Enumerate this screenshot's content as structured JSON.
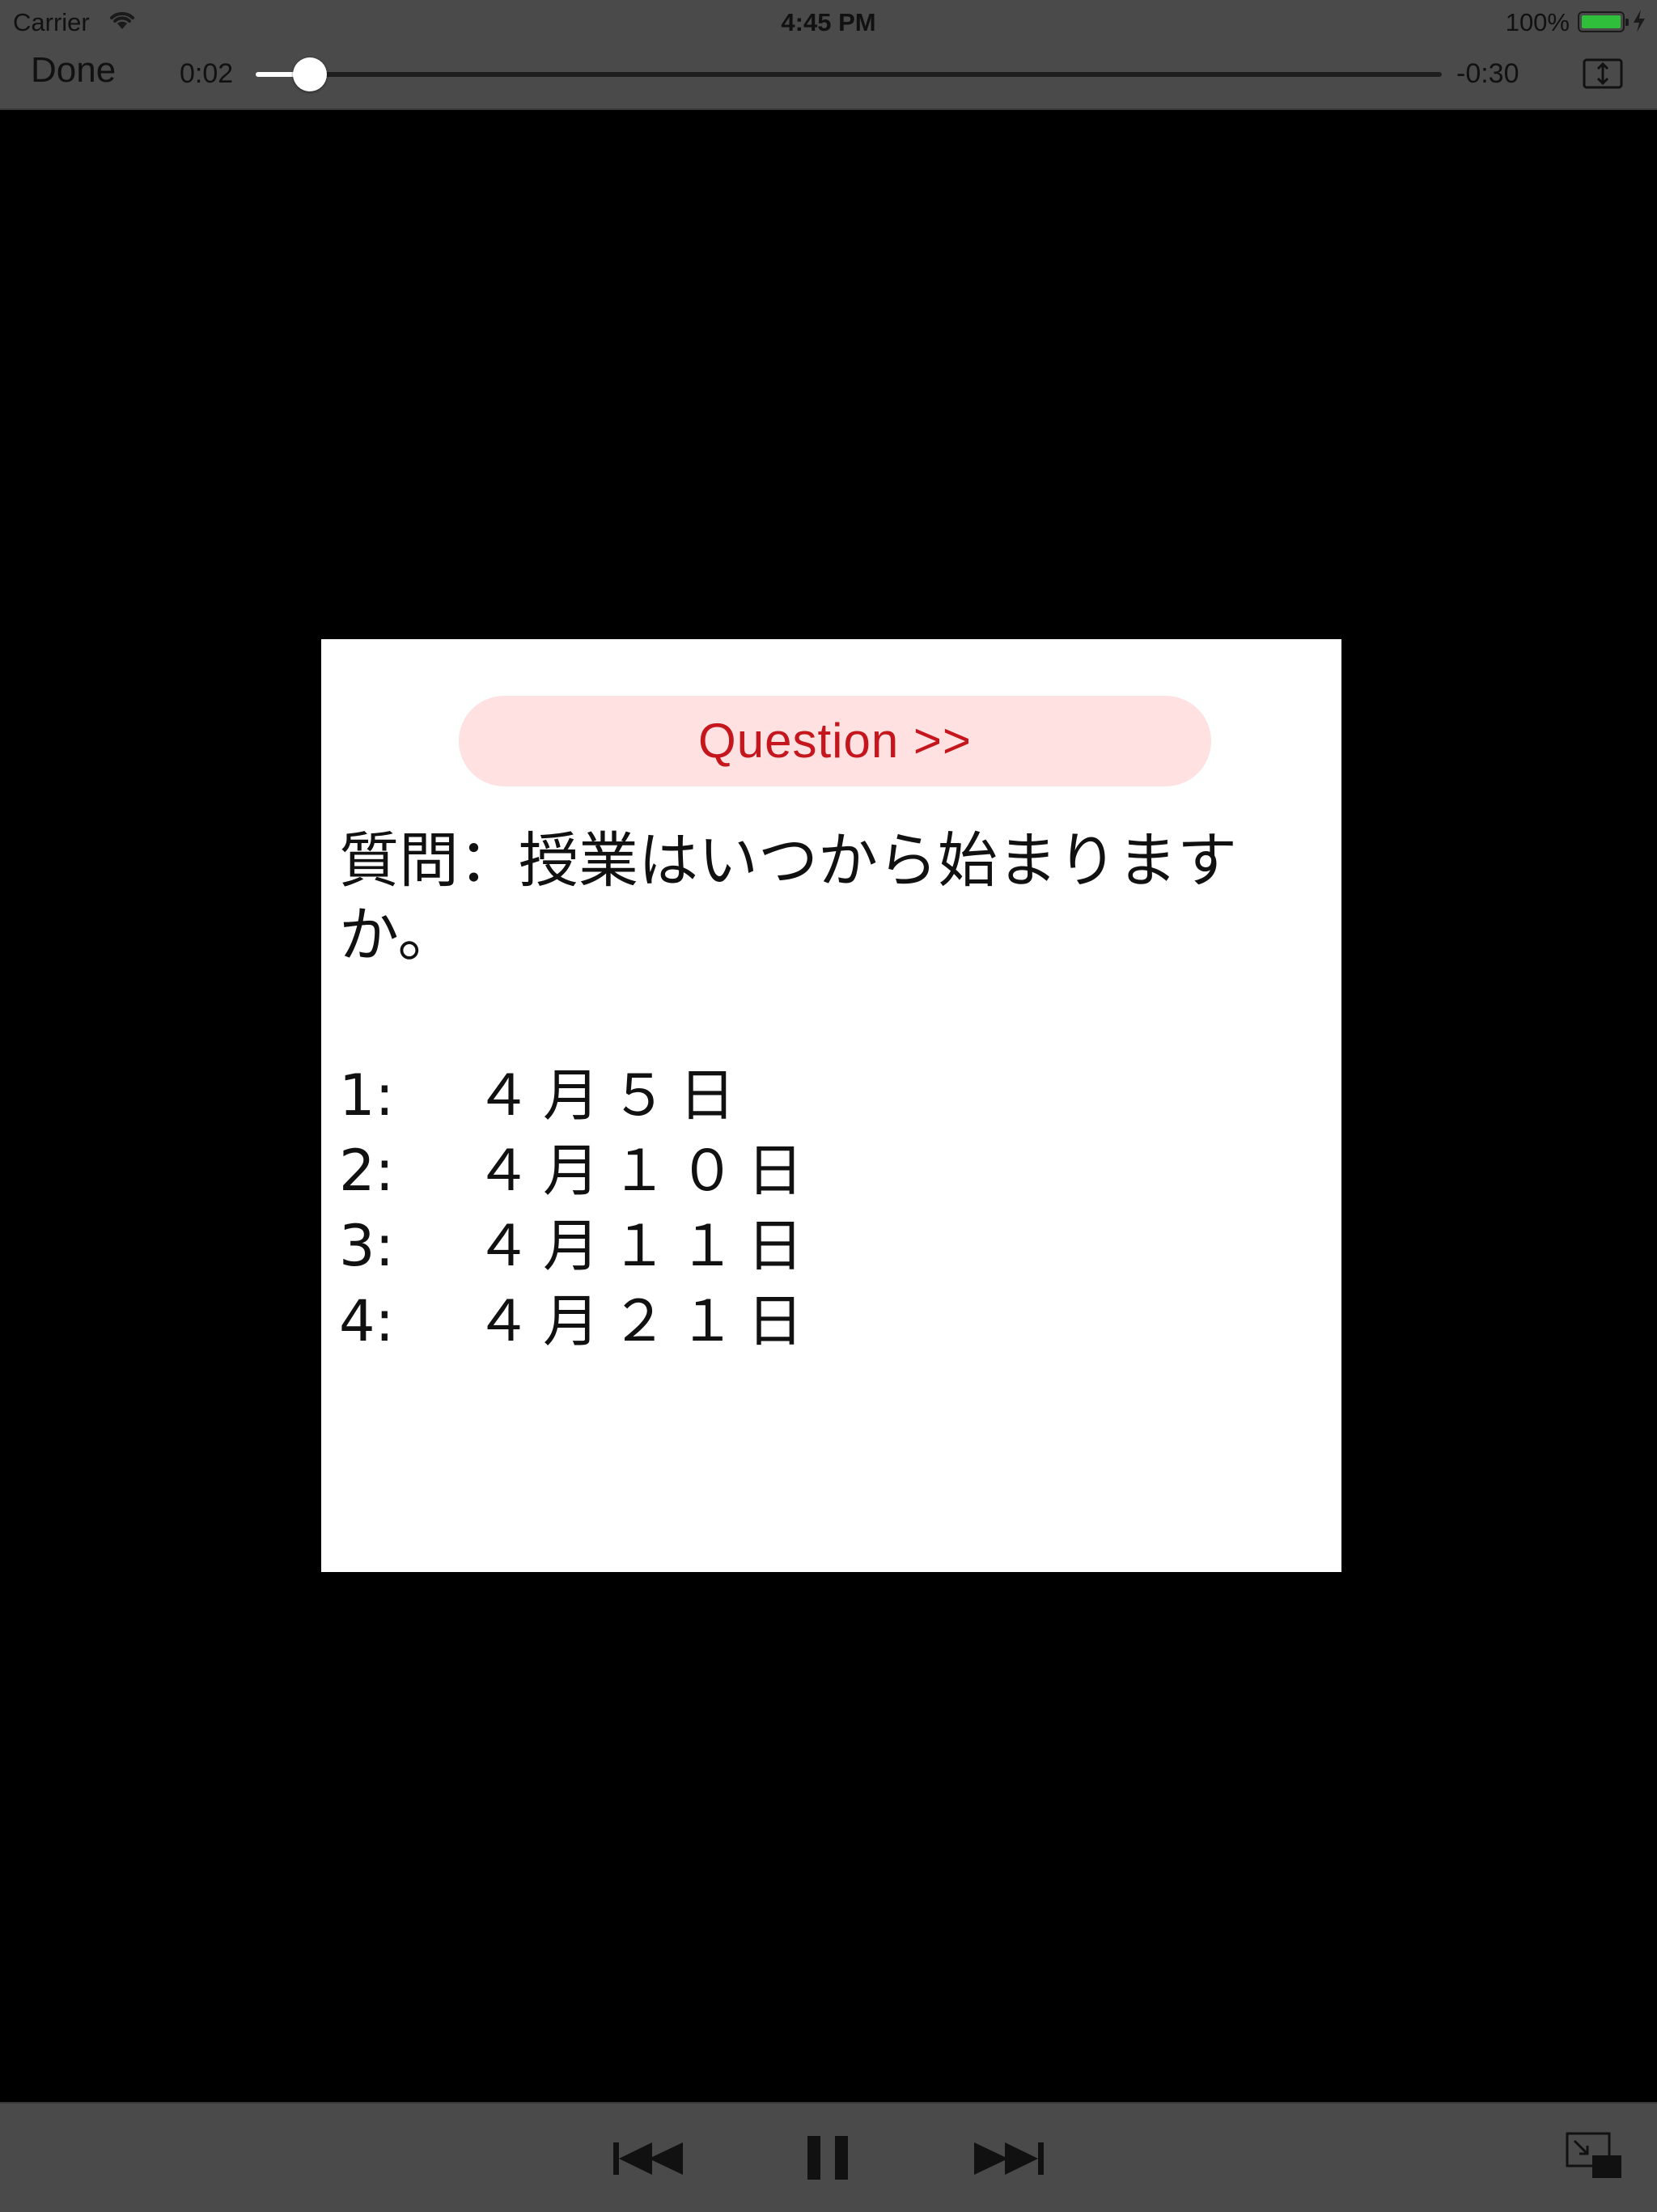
{
  "status_bar": {
    "carrier": "Carrier",
    "time": "4:45 PM",
    "battery_percent": "100%",
    "battery_level": 1.0
  },
  "player": {
    "done_label": "Done",
    "elapsed": "0:02",
    "remaining": "-0:30",
    "progress": 0.0455
  },
  "video": {
    "question_banner": "Question >>",
    "question_text": "質問：授業はいつから始まりますか。",
    "options": [
      {
        "num": "1:",
        "value": "４月５日"
      },
      {
        "num": "2:",
        "value": "４月１０日"
      },
      {
        "num": "3:",
        "value": "４月１１日"
      },
      {
        "num": "4:",
        "value": "４月２１日"
      }
    ]
  },
  "controls": {
    "icons": [
      "skip-back-icon",
      "pause-icon",
      "skip-forward-icon",
      "picture-in-picture-icon",
      "aspect-ratio-icon"
    ]
  },
  "colors": {
    "bar_bg": "#4a4a4a",
    "banner_bg": "#ffe1e1",
    "banner_text": "#c4161c",
    "battery": "#2fbf3a"
  }
}
